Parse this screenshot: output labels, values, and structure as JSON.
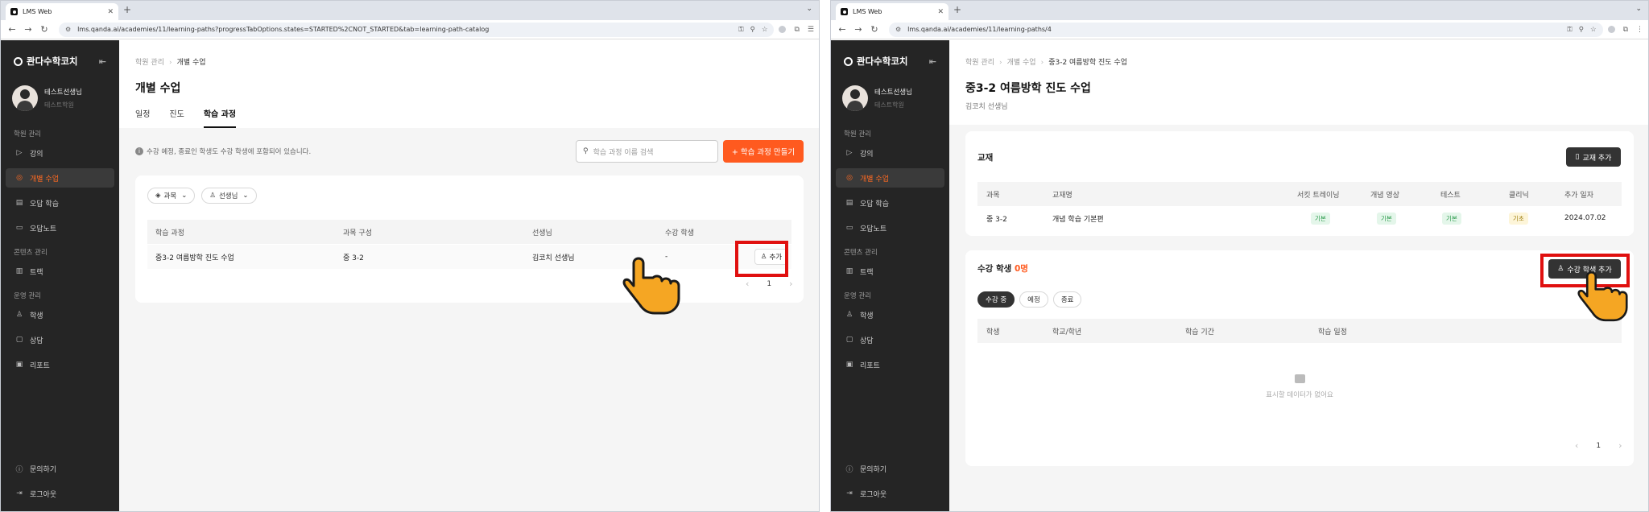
{
  "left": {
    "tab_title": "LMS Web",
    "url": "lms.qanda.ai/academies/11/learning-paths?progressTabOptions.states=STARTED%2CNOT_STARTED&tab=learning-path-catalog",
    "brand": "콴다수학코치",
    "profile": {
      "name": "테스트선생님",
      "role": "테스트학원"
    },
    "nav": {
      "sec1": "학원 관리",
      "lectures": "강의",
      "individual": "개별 수업",
      "wrong": "오답 학습",
      "wrongnote": "오답노트",
      "sec2": "콘텐츠 관리",
      "track": "트랙",
      "sec3": "운영 관리",
      "student": "학생",
      "consult": "상담",
      "report": "리포트",
      "inquiry": "문의하기",
      "logout": "로그아웃"
    },
    "breadcrumb": {
      "root": "학원 관리",
      "current": "개별 수업"
    },
    "title": "개별 수업",
    "tabs": {
      "schedule": "일정",
      "progress": "진도",
      "path": "학습 과정"
    },
    "info": "수강 예정, 종료인 학생도 수강 학생에 포함되어 있습니다.",
    "search_placeholder": "학습 과정 이름 검색",
    "create_button": "+ 학습 과정 만들기",
    "filters": {
      "subject": "과목",
      "teacher": "선생님"
    },
    "table": {
      "headers": [
        "학습 과정",
        "과목 구성",
        "선생님",
        "수강 학생"
      ],
      "row": {
        "name": "중3-2 여름방학 진도 수업",
        "subject": "중 3-2",
        "teacher": "김코치 선생님",
        "students": "-",
        "add": "추가"
      }
    },
    "page": "1"
  },
  "right": {
    "tab_title": "LMS Web",
    "url": "lms.qanda.ai/academies/11/learning-paths/4",
    "brand": "콴다수학코치",
    "profile": {
      "name": "테스트선생님",
      "role": "테스트학원"
    },
    "nav": {
      "sec1": "학원 관리",
      "lectures": "강의",
      "individual": "개별 수업",
      "wrong": "오답 학습",
      "wrongnote": "오답노트",
      "sec2": "콘텐츠 관리",
      "track": "트랙",
      "sec3": "운영 관리",
      "student": "학생",
      "consult": "상담",
      "report": "리포트",
      "inquiry": "문의하기",
      "logout": "로그아웃"
    },
    "breadcrumb": {
      "root": "학원 관리",
      "mid": "개별 수업",
      "current": "중3-2 여름방학 진도 수업"
    },
    "title": "중3-2 여름방학 진도 수업",
    "subtitle": "김코치 선생님",
    "textbook": {
      "title": "교재",
      "add_button": "교재 추가",
      "headers": [
        "과목",
        "교재명",
        "서킷 트레이닝",
        "개념 영상",
        "테스트",
        "클리닉",
        "추가 일자"
      ],
      "row": {
        "subject": "중 3-2",
        "name": "개념 학습 기본편",
        "circuit": "기본",
        "concept": "기본",
        "test": "기본",
        "clinic": "기초",
        "date": "2024.07.02"
      }
    },
    "students": {
      "title": "수강 학생",
      "count": "0명",
      "add_button": "수강 학생 추가",
      "filters": {
        "current": "수강 중",
        "planned": "예정",
        "ended": "종료"
      },
      "headers": [
        "학생",
        "학교/학년",
        "학습 기간",
        "학습 일정"
      ],
      "empty": "표시할 데이터가 없어요"
    },
    "page": "1"
  },
  "colors": {
    "accent": "#ff5a1f",
    "sidebar": "#252525",
    "highlight": "#e0100f",
    "cursor": "#f5a623"
  }
}
